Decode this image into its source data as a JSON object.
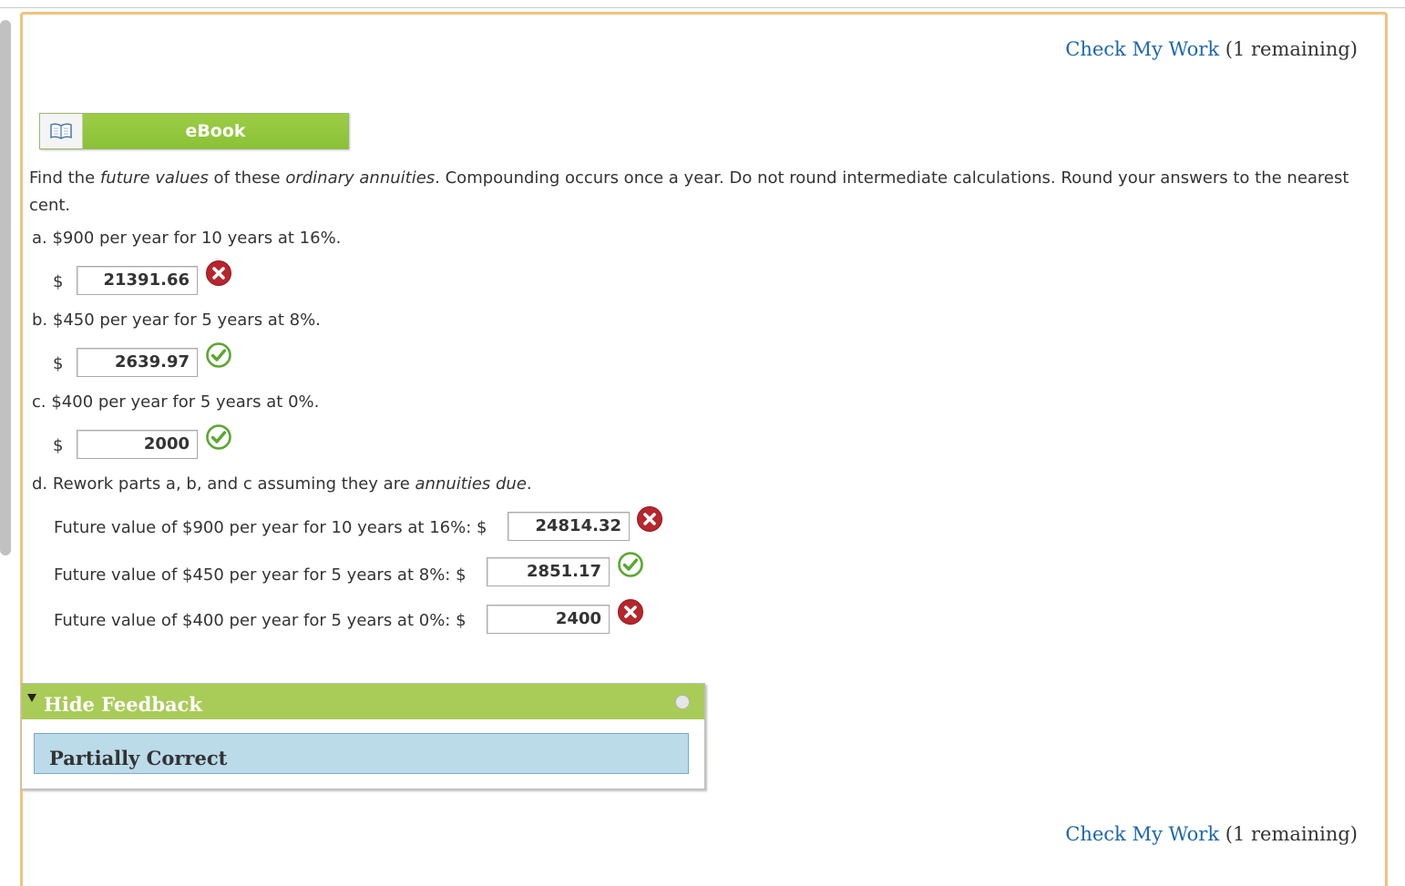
{
  "header": {
    "check_label": "Check My Work",
    "check_remaining": "(1 remaining)"
  },
  "footer": {
    "check_label": "Check My Work",
    "check_remaining": "(1 remaining)"
  },
  "ebook": {
    "label": "eBook",
    "icon": "book-icon"
  },
  "problem": {
    "intro_pre": "Find the ",
    "intro_em1": "future values",
    "intro_mid1": " of these ",
    "intro_em2": "ordinary annuities",
    "intro_rest_line1": ". Compounding occurs once a year. Do not round intermediate calculations. Round your answers to the nearest",
    "intro_line2": "cent.",
    "parts": [
      {
        "question": "a. $900 per year for 10 years at 16%.",
        "currency": "$",
        "answer": "21391.66",
        "status": "incorrect"
      },
      {
        "question": "b. $450 per year for 5 years at 8%.",
        "currency": "$",
        "answer": "2639.97",
        "status": "correct"
      },
      {
        "question": "c. $400 per year for 5 years at 0%.",
        "currency": "$",
        "answer": "2000",
        "status": "correct"
      }
    ],
    "part_d": {
      "question_pre": "d. Rework parts a, b, and c assuming they are ",
      "question_em": "annuities due",
      "question_post": ".",
      "rows": [
        {
          "label": "Future value of $900 per year for 10 years at 16%: $",
          "answer": "24814.32",
          "status": "incorrect"
        },
        {
          "label": "Future value of $450 per year for 5 years at 8%: $",
          "answer": "2851.17",
          "status": "correct"
        },
        {
          "label": "Future value of $400 per year for 5 years at 0%: $",
          "answer": "2400",
          "status": "incorrect"
        }
      ]
    }
  },
  "feedback": {
    "toggle_label": "Hide Feedback",
    "result": "Partially Correct"
  },
  "colors": {
    "link": "#1c66ad",
    "correct": "#5aa632",
    "incorrect": "#b8252a",
    "feedback_header": "#a9cb58",
    "feedback_body": "#bbdbe9",
    "panel_border": "#f2c27c"
  }
}
